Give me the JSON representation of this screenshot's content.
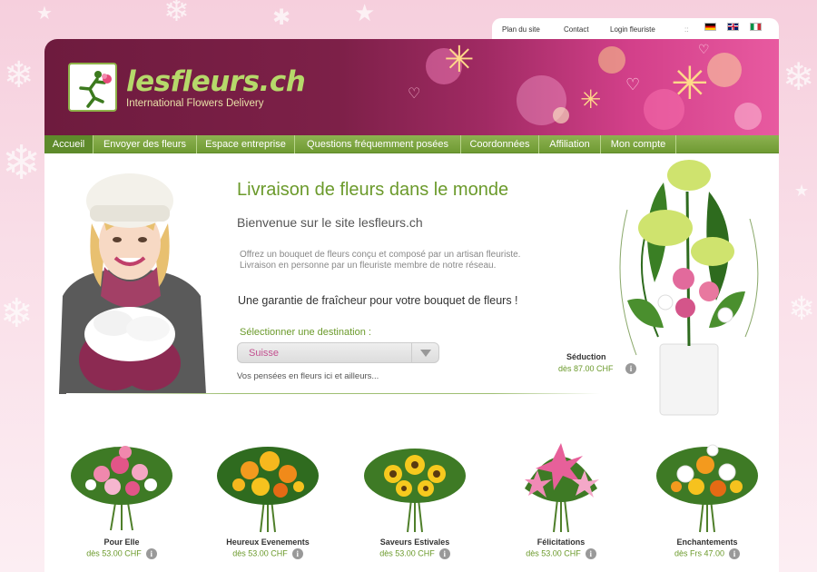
{
  "top_links": {
    "sitemap": "Plan du site",
    "contact": "Contact",
    "florist_login": "Login fleuriste",
    "separator": "::"
  },
  "languages": [
    "de",
    "en",
    "it"
  ],
  "brand": {
    "name": "lesfleurs.ch",
    "subtitle": "International Flowers Delivery"
  },
  "nav": [
    {
      "label": "Accueil",
      "active": true
    },
    {
      "label": "Envoyer des fleurs",
      "active": false
    },
    {
      "label": "Espace entreprise",
      "active": false
    },
    {
      "label": "Questions fréquemment posées",
      "active": false
    },
    {
      "label": "Coordonnées",
      "active": false
    },
    {
      "label": "Affiliation",
      "active": false
    },
    {
      "label": "Mon compte",
      "active": false
    }
  ],
  "hero": {
    "title": "Livraison de fleurs dans le monde",
    "welcome": "Bienvenue sur le site lesfleurs.ch",
    "intro": "Offrez un bouquet de fleurs conçu et composé par un artisan fleuriste. Livraison en personne par un fleuriste membre de notre réseau.",
    "guarantee": "Une garantie de fraîcheur pour votre bouquet de fleurs !",
    "destination_label": "Sélectionner une destination :",
    "destination_value": "Suisse",
    "tagline": "Vos pensées en fleurs ici et ailleurs..."
  },
  "featured": {
    "name": "Séduction",
    "price": "dès 87.00 CHF",
    "info_icon": "i"
  },
  "products": [
    {
      "name": "Pour Elle",
      "price": "dès 53.00 CHF",
      "info_icon": "i"
    },
    {
      "name": "Heureux Evenements",
      "price": "dès 53.00 CHF",
      "info_icon": "i"
    },
    {
      "name": "Saveurs Estivales",
      "price": "dès 53.00 CHF",
      "info_icon": "i"
    },
    {
      "name": "Félicitations",
      "price": "dès 53.00 CHF",
      "info_icon": "i"
    },
    {
      "name": "Enchantements",
      "price": "dès Frs 47.00",
      "info_icon": "i"
    }
  ],
  "colors": {
    "brand_green": "#6b9a2b",
    "banner_purple": "#7d2048",
    "select_text": "#c2508f"
  }
}
